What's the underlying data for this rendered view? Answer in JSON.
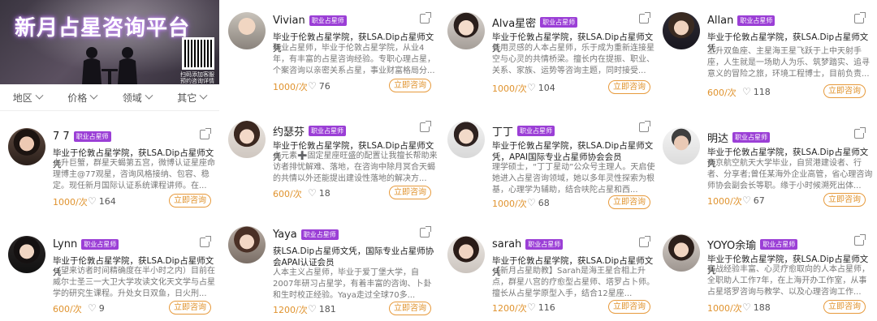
{
  "banner": {
    "title": "新月占星咨询平台",
    "qr_caption": "扫码添加客服 预约咨询详情"
  },
  "filters": [
    {
      "label": "地区"
    },
    {
      "label": "价格"
    },
    {
      "label": "领域"
    },
    {
      "label": "其它"
    }
  ],
  "tag_label": "职业占星师",
  "consult_label": "立即咨询",
  "cards": [
    {
      "name": "Vivian",
      "cred": "毕业于伦敦占星学院，获LSA.Dip占星师文凭",
      "desc": "职业占星师，毕业于伦敦占星学院，从业4年，有丰富的占星咨询经验。专职心理占星，个案咨询以亲密关系占星，事业财富格局分...",
      "price": "1000/次",
      "likes": "76"
    },
    {
      "name": "Alva星密",
      "cred": "毕业于伦敦占星学院，获LSA.Dip占星师文凭",
      "desc": "善用灵感的人本占星师，乐于成为重新连接星空与心灵的共情桥梁。擅长内在提振、职业、关系、家族、运势等咨询主题，同时接受...",
      "price": "1000/次",
      "likes": "104"
    },
    {
      "name": "Allan",
      "cred": "毕业于伦敦占星学院，获LSA.Dip占星师文凭",
      "desc": "上升双鱼座、主星海王星飞跃于上中天射手座，人生就是一场助人为乐、筑梦踏实、追寻意义的冒险之旅，环境工程博士，目前负责...",
      "price": "600/次",
      "likes": "118"
    },
    {
      "name": "7 7",
      "cred": "毕业于伦敦占星学院，获LSA.Dip占星师文凭",
      "desc": "上升巨蟹，群星天蝎第五宫，微博认证星座命理博主@77观星，咨询风格接纳、包容、稳定。现任新月国际认证系统课程讲师。在...",
      "price": "1000/次",
      "likes": "164"
    },
    {
      "name": "约瑟芬",
      "cred": "毕业于伦敦占星学院，获LSA.Dip占星师文凭",
      "desc": "土元素➕固定星座旺盛的配置让我擅长帮助来访者排忧解难、落地，在咨询中除月冥合天蝎的共情以外还能提出建设性落地的解决方...",
      "price": "600/次",
      "likes": "18"
    },
    {
      "name": "丁丁",
      "cred": "毕业于伦敦占星学院，获LSA.Dip占星师文凭，APAI国际专业占星师协会会员",
      "desc": "理学硕士，“丁丁星动”公众号主理人。天启使她进入占星咨询领域，她以多年灵性探索为根基，心理学为辅助，结合呋陀占星和西...",
      "price": "1000/次",
      "likes": "68"
    },
    {
      "name": "明达",
      "cred": "毕业于伦敦占星学院，获LSA.Dip占星师文凭",
      "desc": "南京航空航天大学毕业，自贸港建设者、行者、分享者;曾任某海外企业高管，省心理咨询师协会副会长等职。缘于小时候溯死出体...",
      "price": "1000/次",
      "likes": "67"
    },
    {
      "name": "Lynn",
      "cred": "毕业于伦敦占星学院，获LSA.Dip占星师文凭",
      "desc": "（望来访者时间精确度在半小时之内）目前在威尔士圣三一大卫大学攻读文化天文学与占星学的研究生课程。升处女日双鱼，日火刑...",
      "price": "600/次",
      "likes": "9"
    },
    {
      "name": "Yaya",
      "cred": "获LSA.Dip占星师文凭，国际专业占星师协会APAI认证会员",
      "desc": "人本主义占星师，毕业于爱丁堡大学，自2007年研习占星学，有着丰富的咨询、卜卦和生时校正经验。Yaya走过全球70多...",
      "price": "1200/次",
      "likes": "181"
    },
    {
      "name": "sarah",
      "cred": "毕业于伦敦占星学院，获LSA.Dip占星师文凭",
      "desc": "【新月占星助教】Sarah是海王星合相上升点，群星八宫的疗愈型占星师、塔罗占卜师。擅长从占星学原型入手，结合12星座...",
      "price": "1200/次",
      "likes": "116"
    },
    {
      "name": "YOYO余瑜",
      "cred": "毕业于伦敦占星学院，获LSA.Dip占星师文凭",
      "desc": "实战经验丰富、心灵疗愈取向的人本占星师，全职助人工作7年，在上海开办工作室，从事占星塔罗咨询与教学、以及心理咨询工作...",
      "price": "1000/次",
      "likes": "188"
    }
  ]
}
